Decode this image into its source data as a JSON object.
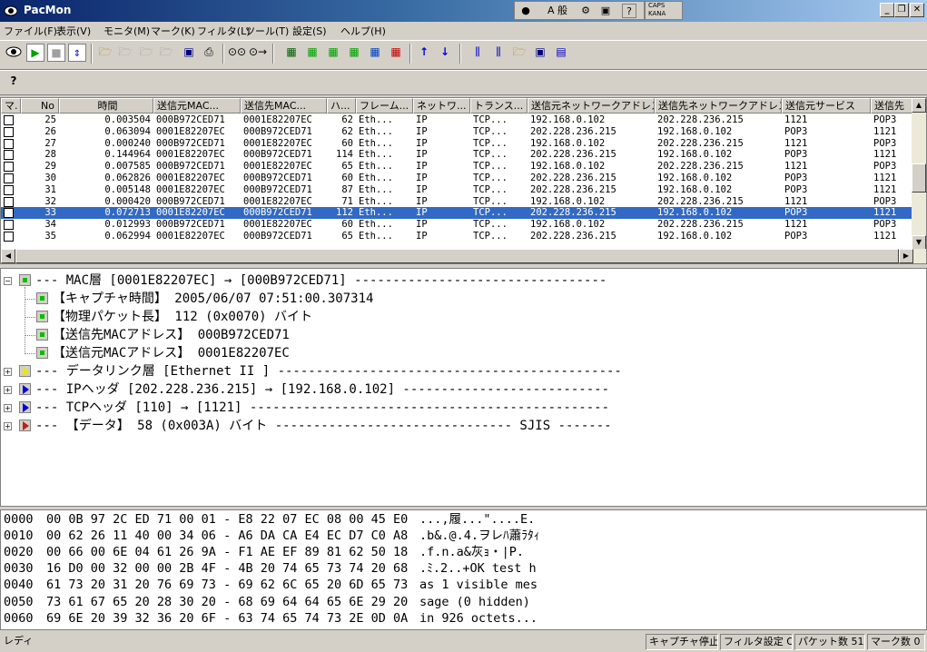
{
  "window": {
    "title": "PacMon"
  },
  "tray": {
    "caps": "CAPS",
    "kana": "KANA",
    "ime": "A 般"
  },
  "menu": [
    "ファイル(F)",
    "表示(V)",
    "モニタ(M)",
    "マーク(K)",
    "フィルタ(L)",
    "ツール(T)",
    "設定(S)",
    "ヘルプ(H)"
  ],
  "list": {
    "headers": [
      "マ.",
      "No",
      "時間",
      "送信元MAC...",
      "送信先MAC...",
      "ハ...",
      "フレーム...",
      "ネットワ...",
      "トランス...",
      "送信元ネットワークアドレス",
      "送信先ネットワークアドレス",
      "送信元サービス",
      "送信先"
    ],
    "rows": [
      {
        "no": "25",
        "time": "0.003504",
        "src_mac": "000B972CED71",
        "dst_mac": "0001E82207EC",
        "len": "62",
        "frame": "Eth...",
        "net": "IP",
        "trans": "TCP...",
        "src_addr": "192.168.0.102",
        "dst_addr": "202.228.236.215",
        "src_svc": "1121",
        "dst_svc": "POP3"
      },
      {
        "no": "26",
        "time": "0.063094",
        "src_mac": "0001E82207EC",
        "dst_mac": "000B972CED71",
        "len": "62",
        "frame": "Eth...",
        "net": "IP",
        "trans": "TCP...",
        "src_addr": "202.228.236.215",
        "dst_addr": "192.168.0.102",
        "src_svc": "POP3",
        "dst_svc": "1121"
      },
      {
        "no": "27",
        "time": "0.000240",
        "src_mac": "000B972CED71",
        "dst_mac": "0001E82207EC",
        "len": "60",
        "frame": "Eth...",
        "net": "IP",
        "trans": "TCP...",
        "src_addr": "192.168.0.102",
        "dst_addr": "202.228.236.215",
        "src_svc": "1121",
        "dst_svc": "POP3"
      },
      {
        "no": "28",
        "time": "0.144964",
        "src_mac": "0001E82207EC",
        "dst_mac": "000B972CED71",
        "len": "114",
        "frame": "Eth...",
        "net": "IP",
        "trans": "TCP...",
        "src_addr": "202.228.236.215",
        "dst_addr": "192.168.0.102",
        "src_svc": "POP3",
        "dst_svc": "1121"
      },
      {
        "no": "29",
        "time": "0.007585",
        "src_mac": "000B972CED71",
        "dst_mac": "0001E82207EC",
        "len": "65",
        "frame": "Eth...",
        "net": "IP",
        "trans": "TCP...",
        "src_addr": "192.168.0.102",
        "dst_addr": "202.228.236.215",
        "src_svc": "1121",
        "dst_svc": "POP3"
      },
      {
        "no": "30",
        "time": "0.062826",
        "src_mac": "0001E82207EC",
        "dst_mac": "000B972CED71",
        "len": "60",
        "frame": "Eth...",
        "net": "IP",
        "trans": "TCP...",
        "src_addr": "202.228.236.215",
        "dst_addr": "192.168.0.102",
        "src_svc": "POP3",
        "dst_svc": "1121"
      },
      {
        "no": "31",
        "time": "0.005148",
        "src_mac": "0001E82207EC",
        "dst_mac": "000B972CED71",
        "len": "87",
        "frame": "Eth...",
        "net": "IP",
        "trans": "TCP...",
        "src_addr": "202.228.236.215",
        "dst_addr": "192.168.0.102",
        "src_svc": "POP3",
        "dst_svc": "1121"
      },
      {
        "no": "32",
        "time": "0.000420",
        "src_mac": "000B972CED71",
        "dst_mac": "0001E82207EC",
        "len": "71",
        "frame": "Eth...",
        "net": "IP",
        "trans": "TCP...",
        "src_addr": "192.168.0.102",
        "dst_addr": "202.228.236.215",
        "src_svc": "1121",
        "dst_svc": "POP3"
      },
      {
        "no": "33",
        "time": "0.072713",
        "src_mac": "0001E82207EC",
        "dst_mac": "000B972CED71",
        "len": "112",
        "frame": "Eth...",
        "net": "IP",
        "trans": "TCP...",
        "src_addr": "202.228.236.215",
        "dst_addr": "192.168.0.102",
        "src_svc": "POP3",
        "dst_svc": "1121",
        "selected": true
      },
      {
        "no": "34",
        "time": "0.012993",
        "src_mac": "000B972CED71",
        "dst_mac": "0001E82207EC",
        "len": "60",
        "frame": "Eth...",
        "net": "IP",
        "trans": "TCP...",
        "src_addr": "192.168.0.102",
        "dst_addr": "202.228.236.215",
        "src_svc": "1121",
        "dst_svc": "POP3"
      },
      {
        "no": "35",
        "time": "0.062994",
        "src_mac": "0001E82207EC",
        "dst_mac": "000B972CED71",
        "len": "65",
        "frame": "Eth...",
        "net": "IP",
        "trans": "TCP...",
        "src_addr": "202.228.236.215",
        "dst_addr": "192.168.0.102",
        "src_svc": "POP3",
        "dst_svc": "1121"
      }
    ]
  },
  "tree": [
    {
      "text": "--- MAC層 [0001E82207EC] → [000B972CED71] ---------------------------------",
      "icon": "green",
      "expander": "−",
      "level": 0
    },
    {
      "text": "【キャプチャ時間】 2005/06/07 07:51:00.307314",
      "icon": "green",
      "level": 1
    },
    {
      "text": "【物理パケット長】 112 (0x0070) バイト",
      "icon": "green",
      "level": 1
    },
    {
      "text": "【送信先MACアドレス】 000B972CED71",
      "icon": "green",
      "level": 1
    },
    {
      "text": "【送信元MACアドレス】 0001E82207EC",
      "icon": "green",
      "level": 1
    },
    {
      "text": "--- データリンク層 [Ethernet II ]  ---------------------------------------------",
      "icon": "yellow",
      "expander": "+",
      "level": 0
    },
    {
      "text": "--- IPヘッダ [202.228.236.215] → [192.168.0.102] ---------------------------",
      "icon": "blue",
      "expander": "+",
      "level": 0
    },
    {
      "text": "--- TCPヘッダ [110] → [1121] -----------------------------------------------",
      "icon": "blue",
      "expander": "+",
      "level": 0
    },
    {
      "text": "--- 【データ】 58 (0x003A) バイト ------------------------------- SJIS -------",
      "icon": "red",
      "expander": "+",
      "level": 0
    }
  ],
  "hex": [
    {
      "offset": "0000",
      "bytes": "00 0B 97 2C ED 71 00 01 - E8 22 07 EC 08 00 45 E0",
      "ascii": "...,履...\"....E."
    },
    {
      "offset": "0010",
      "bytes": "00 62 26 11 40 00 34 06 - A6 DA CA E4 EC D7 C0 A8",
      "ascii": ".b&.@.4.ヲレﾊ蕭ﾗﾀｨ"
    },
    {
      "offset": "0020",
      "bytes": "00 66 00 6E 04 61 26 9A - F1 AE EF 89 81 62 50 18",
      "ascii": ".f.n.a&灰ｮ・|P."
    },
    {
      "offset": "0030",
      "bytes": "16 D0 00 32 00 00 2B 4F - 4B 20 74 65 73 74 20 68",
      "ascii": ".ﾐ.2..+OK test h"
    },
    {
      "offset": "0040",
      "bytes": "61 73 20 31 20 76 69 73 - 69 62 6C 65 20 6D 65 73",
      "ascii": "as 1 visible mes"
    },
    {
      "offset": "0050",
      "bytes": "73 61 67 65 20 28 30 20 - 68 69 64 64 65 6E 29 20",
      "ascii": "sage (0 hidden) "
    },
    {
      "offset": "0060",
      "bytes": "69 6E 20 39 32 36 20 6F - 63 74 65 74 73 2E 0D 0A",
      "ascii": "in 926 octets..."
    }
  ],
  "status": {
    "main": "レディ",
    "capture": "キャプチャ停止中",
    "filter": "フィルタ設定 OFF",
    "packets": "パケット数 51",
    "marks": "マーク数 0"
  }
}
